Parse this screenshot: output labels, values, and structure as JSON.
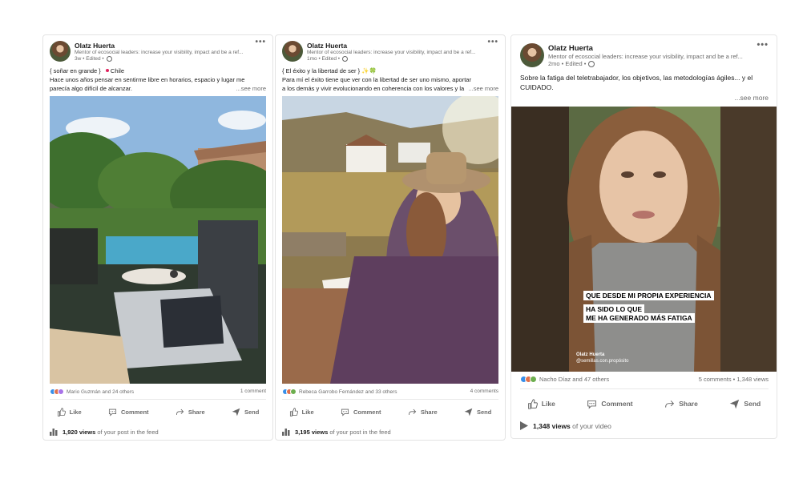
{
  "posts": [
    {
      "author": "Olatz Huerta",
      "headline": "Mentor of ecosocial leaders: increase your visibility, impact and be a ref...",
      "meta": "3w • Edited •",
      "line1": "{ soñar en grande }",
      "line1b": "Chile",
      "line2": "Hace unos años pensar en sentirme libre en horarios, espacio y lugar me parecía algo difícil de alcanzar.",
      "see_more": "...see more",
      "reactions": "Mario Guzmán and 24 others",
      "counts": "1 comment",
      "actions": [
        "Like",
        "Comment",
        "Share",
        "Send"
      ],
      "views_number": "1,920 views",
      "views_text": "of your post in the feed"
    },
    {
      "author": "Olatz Huerta",
      "headline": "Mentor of ecosocial leaders: increase your visibility, impact and be a ref...",
      "meta": "1mo • Edited •",
      "line1": "{ El éxito y la libertad de ser } ✨🍀",
      "line2": "Para mí el éxito tiene que ver con la libertad de ser uno mismo, aportar a los demás y vivir evolucionando en coherencia con los valores y la con",
      "see_more": "...see more",
      "reactions": "Rebeca Garrobo Fernández and 33 others",
      "counts": "4 comments",
      "actions": [
        "Like",
        "Comment",
        "Share",
        "Send"
      ],
      "views_number": "3,195 views",
      "views_text": "of your post in the feed"
    },
    {
      "author": "Olatz Huerta",
      "headline": "Mentor of ecosocial leaders: increase your visibility, impact and be a ref...",
      "meta": "2mo • Edited •",
      "line2": "Sobre la fatiga del teletrabajador, los objetivos, las metodologías ágiles... y el CUIDADO.",
      "see_more": "...see more",
      "video_caption1": "QUE DESDE MI PROPIA EXPERIENCIA",
      "video_caption2": "HA SIDO LO QUE",
      "video_caption3": "ME HA GENERADO MÁS FATIGA",
      "video_credit1": "Olatz Huerta",
      "video_credit2": "@semillas.con.propósito",
      "reactions": "Nacho Díaz and 47 others",
      "counts": "5 comments • 1,348 views",
      "actions": [
        "Like",
        "Comment",
        "Share",
        "Send"
      ],
      "views_number": "1,348 views",
      "views_text": "of your video"
    }
  ],
  "colors": {
    "like": "#378fe9",
    "love": "#df704d",
    "support": "#6dae4f",
    "celebrate": "#a872e8"
  },
  "icons": [
    "more-icon",
    "globe-icon",
    "like-icon",
    "comment-icon",
    "share-icon",
    "send-icon",
    "analytics-icon",
    "play-icon"
  ]
}
